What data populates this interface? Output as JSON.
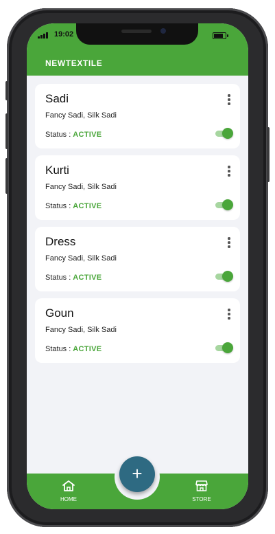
{
  "status_bar": {
    "time": "19:02"
  },
  "app": {
    "title": "NEWTEXTILE"
  },
  "items": [
    {
      "name": "Sadi",
      "subtitle": "Fancy Sadi, Silk Sadi",
      "status_label": "Status :",
      "status": "ACTIVE",
      "enabled": true
    },
    {
      "name": "Kurti",
      "subtitle": "Fancy Sadi, Silk Sadi",
      "status_label": "Status :",
      "status": "ACTIVE",
      "enabled": true
    },
    {
      "name": "Dress",
      "subtitle": "Fancy Sadi, Silk Sadi",
      "status_label": "Status :",
      "status": "ACTIVE",
      "enabled": true
    },
    {
      "name": "Goun",
      "subtitle": "Fancy Sadi, Silk Sadi",
      "status_label": "Status :",
      "status": "ACTIVE",
      "enabled": true
    }
  ],
  "bottom_nav": {
    "home": {
      "label": "HOME",
      "icon": "home-icon"
    },
    "store": {
      "label": "STORE",
      "icon": "store-icon"
    },
    "fab": {
      "label": "+",
      "icon": "plus-icon"
    }
  },
  "colors": {
    "primary": "#4aa63a",
    "fab": "#2e6a82",
    "background": "#f2f3f7"
  }
}
